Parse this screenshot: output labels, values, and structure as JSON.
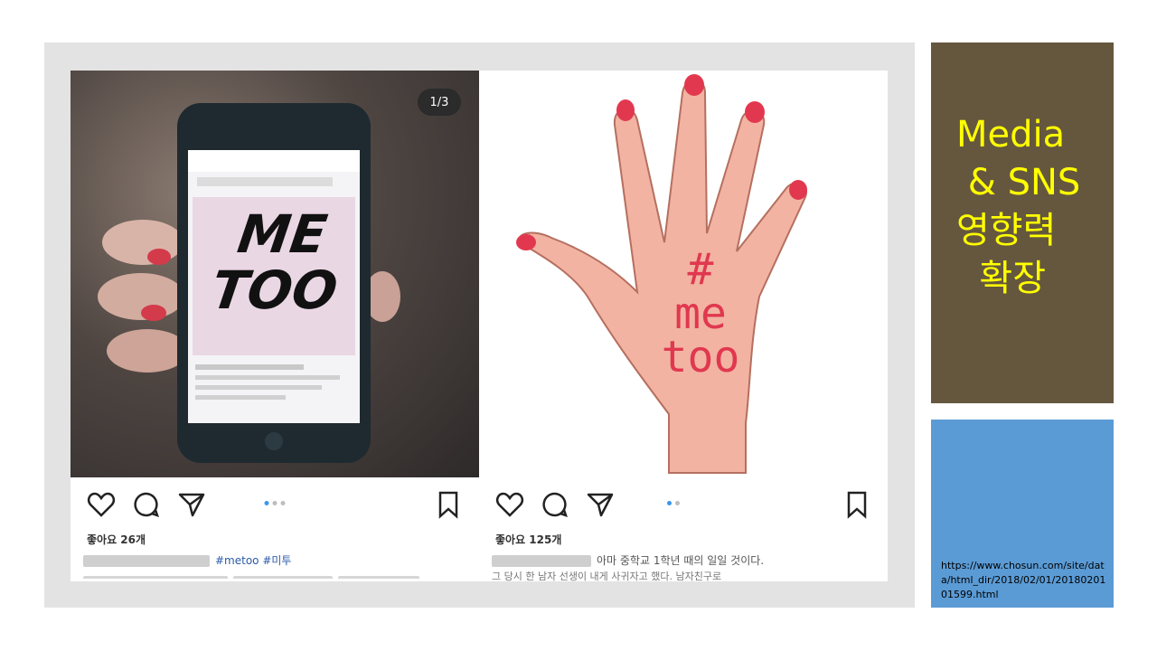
{
  "slide": {
    "title_lines": [
      "Media",
      " & SNS",
      "영향력",
      "  확장"
    ],
    "source_url": "https://www.chosun.com/site/data/html_dir/2018/02/01/2018020101599.html",
    "colors": {
      "title": "#ffff00",
      "brown_panel": "#65573e",
      "blue_panel": "#5b9bd5",
      "frame": "#e3e3e3"
    }
  },
  "collage": {
    "left_post": {
      "page_indicator": "1/3",
      "phone_text_line1": "ME",
      "phone_text_line2": "TOO",
      "likes": "좋아요 26개",
      "caption_tag": "#metoo #미투"
    },
    "right_post": {
      "hand_text_line1": "#",
      "hand_text_line2": "me",
      "hand_text_line3": "too",
      "likes": "좋아요 125개",
      "caption": "아마 중학교 1학년 때의 일일 것이다.",
      "caption_line2": "그 당시 한 남자 선생이 내게 사귀자고 했다. 남자친구로"
    },
    "icons": [
      "heart-icon",
      "comment-icon",
      "share-icon",
      "bookmark-icon"
    ]
  }
}
